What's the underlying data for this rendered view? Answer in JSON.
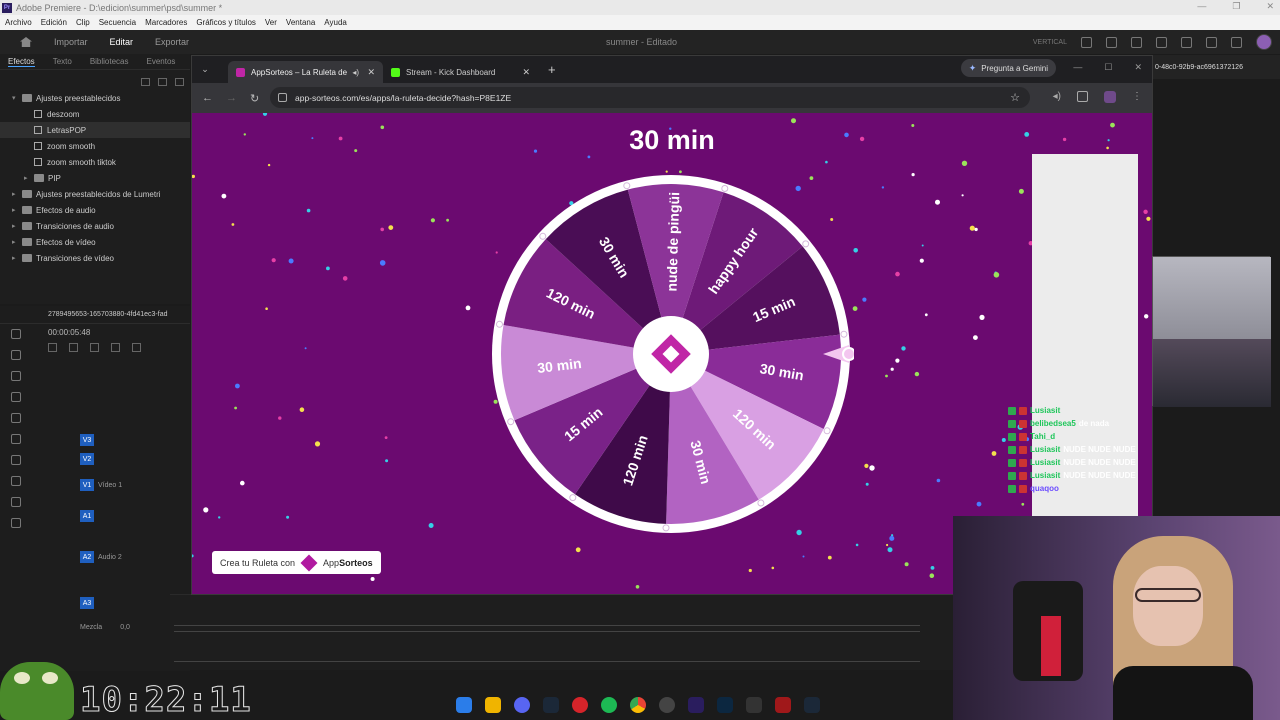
{
  "premiere": {
    "title": "Adobe Premiere - D:\\edicion\\summer\\psd\\summer *",
    "menu": [
      "Archivo",
      "Edición",
      "Clip",
      "Secuencia",
      "Marcadores",
      "Gráficos y títulos",
      "Ver",
      "Ventana",
      "Ayuda"
    ],
    "header_tabs": [
      "Importar",
      "Editar",
      "Exportar"
    ],
    "header_active": "Editar",
    "project_title": "summer - Editado",
    "layout_label": "VERTICAL",
    "panel_tabs": [
      "Efectos",
      "Texto",
      "Bibliotecas",
      "Eventos"
    ],
    "effects_tree": [
      {
        "label": "Ajustes preestablecidos",
        "level": 0,
        "type": "folder",
        "expanded": true
      },
      {
        "label": "deszoom",
        "level": 1,
        "type": "preset"
      },
      {
        "label": "LetrasPOP",
        "level": 1,
        "type": "preset",
        "selected": true
      },
      {
        "label": "zoom smooth",
        "level": 1,
        "type": "preset"
      },
      {
        "label": "zoom smooth tiktok",
        "level": 1,
        "type": "preset"
      },
      {
        "label": "PIP",
        "level": 1,
        "type": "folder"
      },
      {
        "label": "Ajustes preestablecidos de Lumetri",
        "level": 0,
        "type": "folder"
      },
      {
        "label": "Efectos de audio",
        "level": 0,
        "type": "folder"
      },
      {
        "label": "Transiciones de audio",
        "level": 0,
        "type": "folder"
      },
      {
        "label": "Efectos de vídeo",
        "level": 0,
        "type": "folder"
      },
      {
        "label": "Transiciones de vídeo",
        "level": 0,
        "type": "folder"
      }
    ],
    "sequence_name": "2789495653-165703880-4fd41ec3-fad",
    "timecode": "00:00:05:48",
    "tracks": [
      {
        "id": "V3",
        "name": ""
      },
      {
        "id": "V2",
        "name": ""
      },
      {
        "id": "V1",
        "name": "Vídeo 1"
      },
      {
        "id": "A1",
        "name": ""
      },
      {
        "id": "A2",
        "name": "Audio 2"
      },
      {
        "id": "A3",
        "name": ""
      }
    ],
    "mix_label": "Mezcla",
    "mix_value": "0,0",
    "right_id": "0-48c0-92b9-ac6961372126"
  },
  "clock": "10:22:11",
  "browser": {
    "tabs": [
      {
        "label": "AppSorteos – La Ruleta de",
        "active": true,
        "favicon_color": "#c026a6"
      },
      {
        "label": "Stream - Kick Dashboard",
        "active": false,
        "favicon_color": "#53fc18"
      }
    ],
    "gemini_label": "Pregunta a Gemini",
    "url": "app-sorteos.com/es/apps/la-ruleta-decide?hash=P8E1ZE"
  },
  "page": {
    "result": "30 min",
    "wheel_segments": [
      {
        "label": "happy hour",
        "color": "#6e1a78"
      },
      {
        "label": "15 min",
        "color": "#55105e"
      },
      {
        "label": "30 min",
        "color": "#8a2c98"
      },
      {
        "label": "120 min",
        "color": "#d9a0e3"
      },
      {
        "label": "30 min",
        "color": "#b263c2"
      },
      {
        "label": "120 min",
        "color": "#3f0a49"
      },
      {
        "label": "15 min",
        "color": "#7a2288"
      },
      {
        "label": "30 min",
        "color": "#c98ad6"
      },
      {
        "label": "120 min",
        "color": "#7a1f82"
      },
      {
        "label": "30 min",
        "color": "#4a0d55"
      },
      {
        "label": "nude de pingüi",
        "color": "#8c3498"
      }
    ],
    "cta_prefix": "Crea tu Ruleta con",
    "cta_brand_a": "App",
    "cta_brand_b": "Sorteos"
  },
  "chat": [
    {
      "user": "Lusiasit",
      "text": "",
      "badge": "g"
    },
    {
      "user": "belibedsea5",
      "text": "de nada",
      "badge": "g"
    },
    {
      "user": "Tahi_d",
      "text": "",
      "badge": "g"
    },
    {
      "user": "Lusiasit",
      "text": "NUDE NUDE NUDE",
      "badge": "r"
    },
    {
      "user": "Lusiasit",
      "text": "NUDE NUDE NUDE",
      "badge": "r"
    },
    {
      "user": "Lusiasit",
      "text": "NUDE NUDE NUDE",
      "badge": "r"
    },
    {
      "user": "quaqoo",
      "text": "",
      "badge": "p"
    }
  ],
  "colors": {
    "page_bg": "#6b0a70",
    "accent": "#c026a6"
  }
}
